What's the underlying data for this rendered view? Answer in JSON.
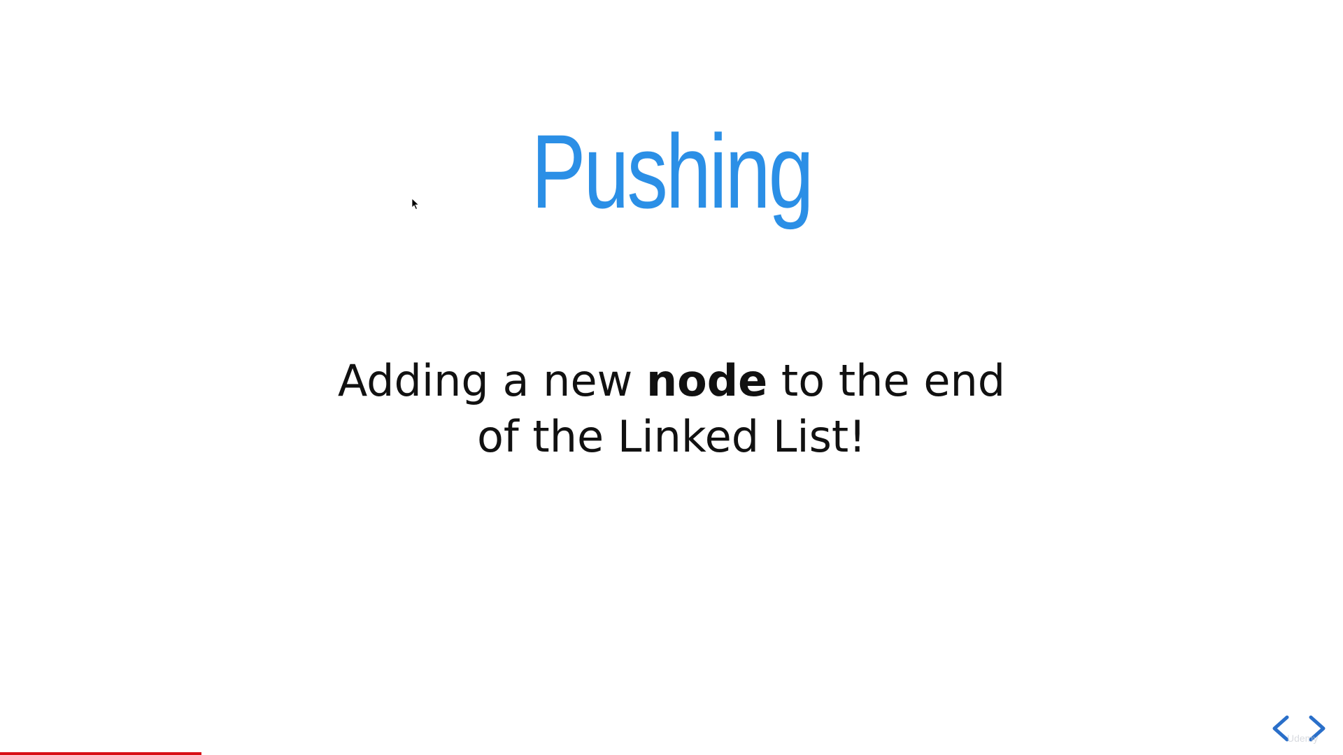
{
  "slide": {
    "title": "Pushing",
    "description_pre": "Adding a new ",
    "description_bold": "node",
    "description_mid": " to the end",
    "description_line2": "of the Linked List!"
  },
  "navigation": {
    "prev_icon": "chevron-left-icon",
    "next_icon": "chevron-right-icon"
  },
  "playback": {
    "progress_percent": 15
  },
  "watermark": {
    "text": "Udemy"
  },
  "colors": {
    "title": "#2b8fe6",
    "nav": "#2a6fc9",
    "progress": "#d80f16"
  }
}
